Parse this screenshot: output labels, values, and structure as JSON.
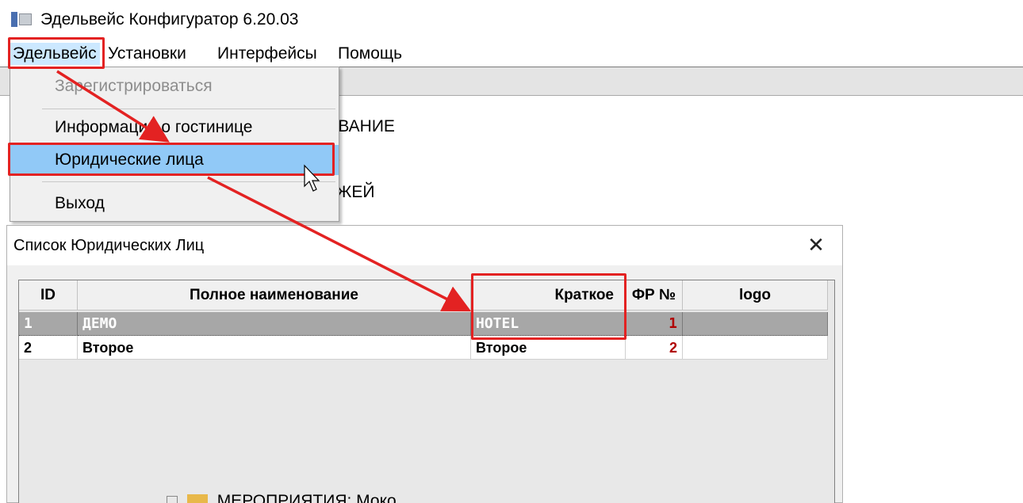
{
  "window": {
    "title": "Эдельвейс Конфигуратор 6.20.03",
    "icon": "app-icon"
  },
  "menu": {
    "items": [
      "Эдельвейс",
      "Установки",
      "Интерфейсы",
      "Помощь"
    ]
  },
  "dropdown": {
    "items": [
      {
        "label": "Зарегистрироваться",
        "state": "disabled"
      },
      {
        "label": "Информация о гостинице",
        "state": "normal"
      },
      {
        "label": "Юридические лица",
        "state": "hover"
      },
      {
        "label": "Выход",
        "state": "normal"
      }
    ]
  },
  "background_fragments": {
    "line1": "ОВАНИЕ",
    "line2": "-",
    "line3": "ЕЖЕЙ",
    "bottom": "МЕРОПРИЯТИЯ: Моко"
  },
  "dialog": {
    "title": "Список Юридических Лиц",
    "close_glyph": "✕",
    "columns": [
      "ID",
      "Полное наименование",
      "Краткое",
      "ФР №",
      "logo"
    ],
    "rows": [
      {
        "id": "1",
        "full": "ДЕМО",
        "short": "HOTEL",
        "fr": "1",
        "logo": "",
        "selected": true
      },
      {
        "id": "2",
        "full": "Второе",
        "short": "Второе",
        "fr": "2",
        "logo": "",
        "selected": false
      }
    ]
  },
  "colors": {
    "highlight": "#e32222",
    "menu_hover": "#91c9f7",
    "selected_row": "#a7a7a7"
  }
}
